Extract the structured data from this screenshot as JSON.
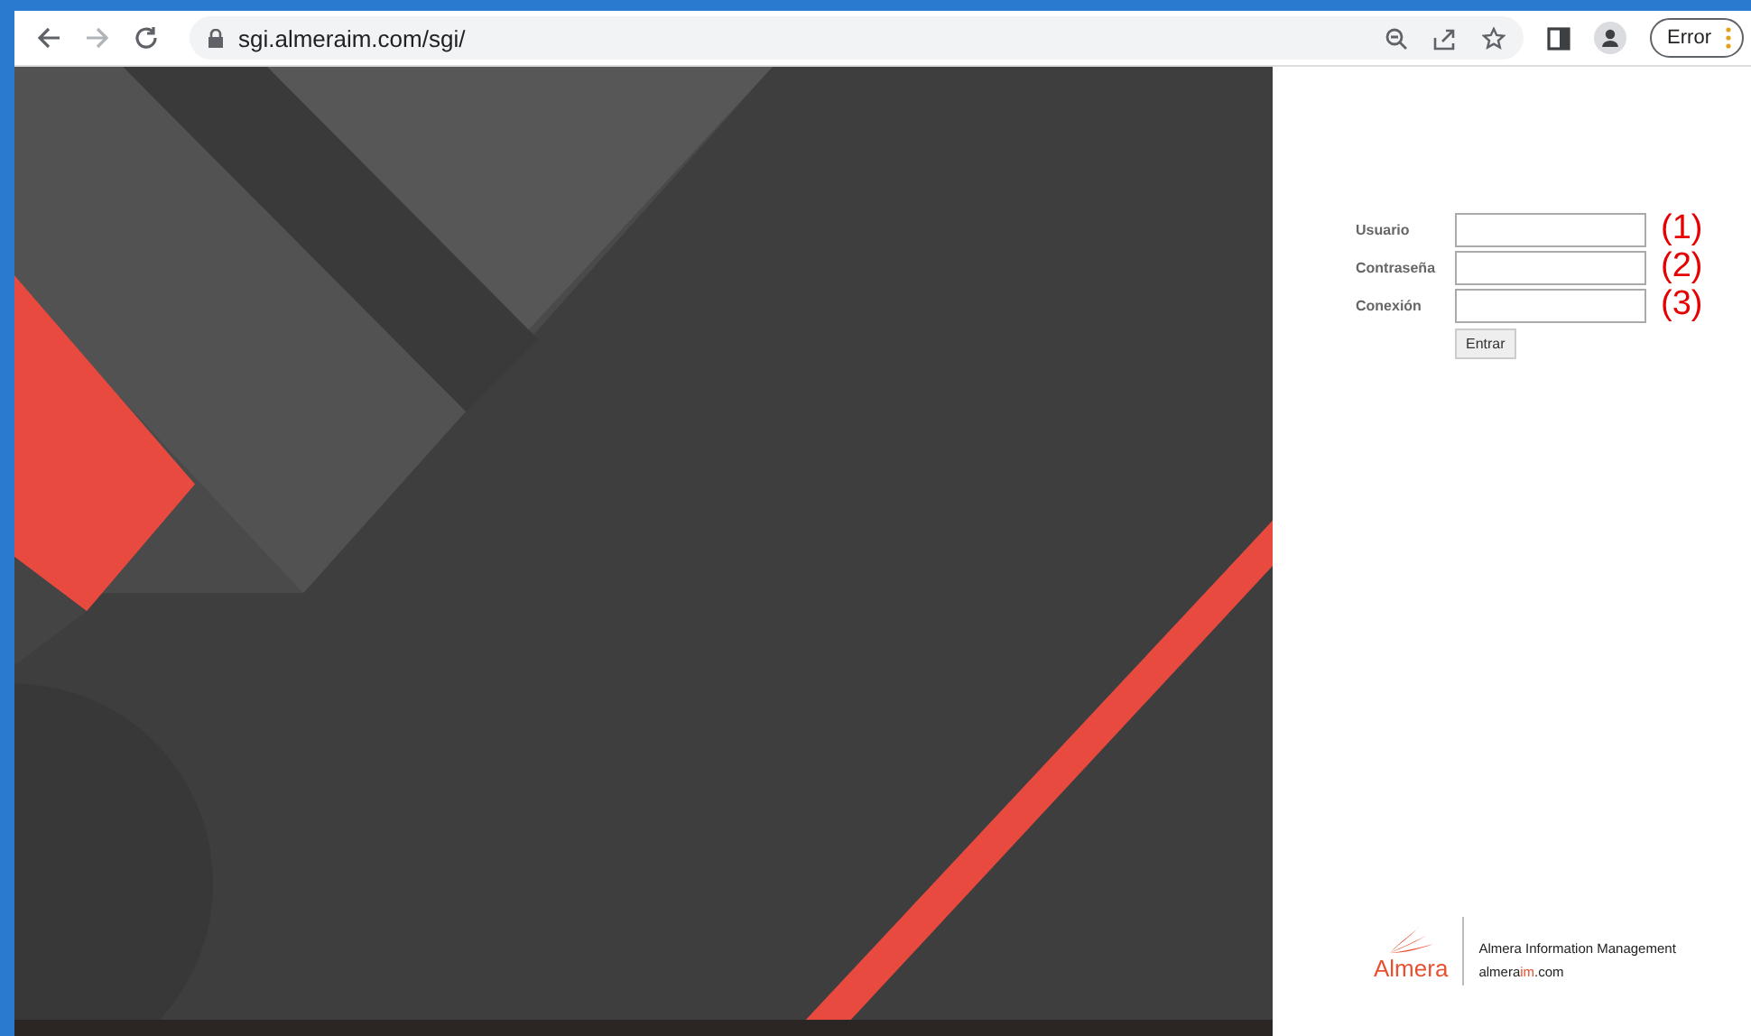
{
  "browser": {
    "url": "sgi.almeraim.com/sgi/",
    "profile_button": "Error"
  },
  "login": {
    "fields": [
      {
        "label": "Usuario",
        "annotation": "(1)"
      },
      {
        "label": "Contraseña",
        "annotation": "(2)"
      },
      {
        "label": "Conexión",
        "annotation": "(3)"
      }
    ],
    "submit": "Entrar"
  },
  "footer": {
    "logo_text": "Almera",
    "company": "Almera Information Management",
    "domain": [
      {
        "text": "almera",
        "highlight": false
      },
      {
        "text": "im",
        "highlight": true
      },
      {
        "text": ".com",
        "highlight": false
      }
    ]
  }
}
